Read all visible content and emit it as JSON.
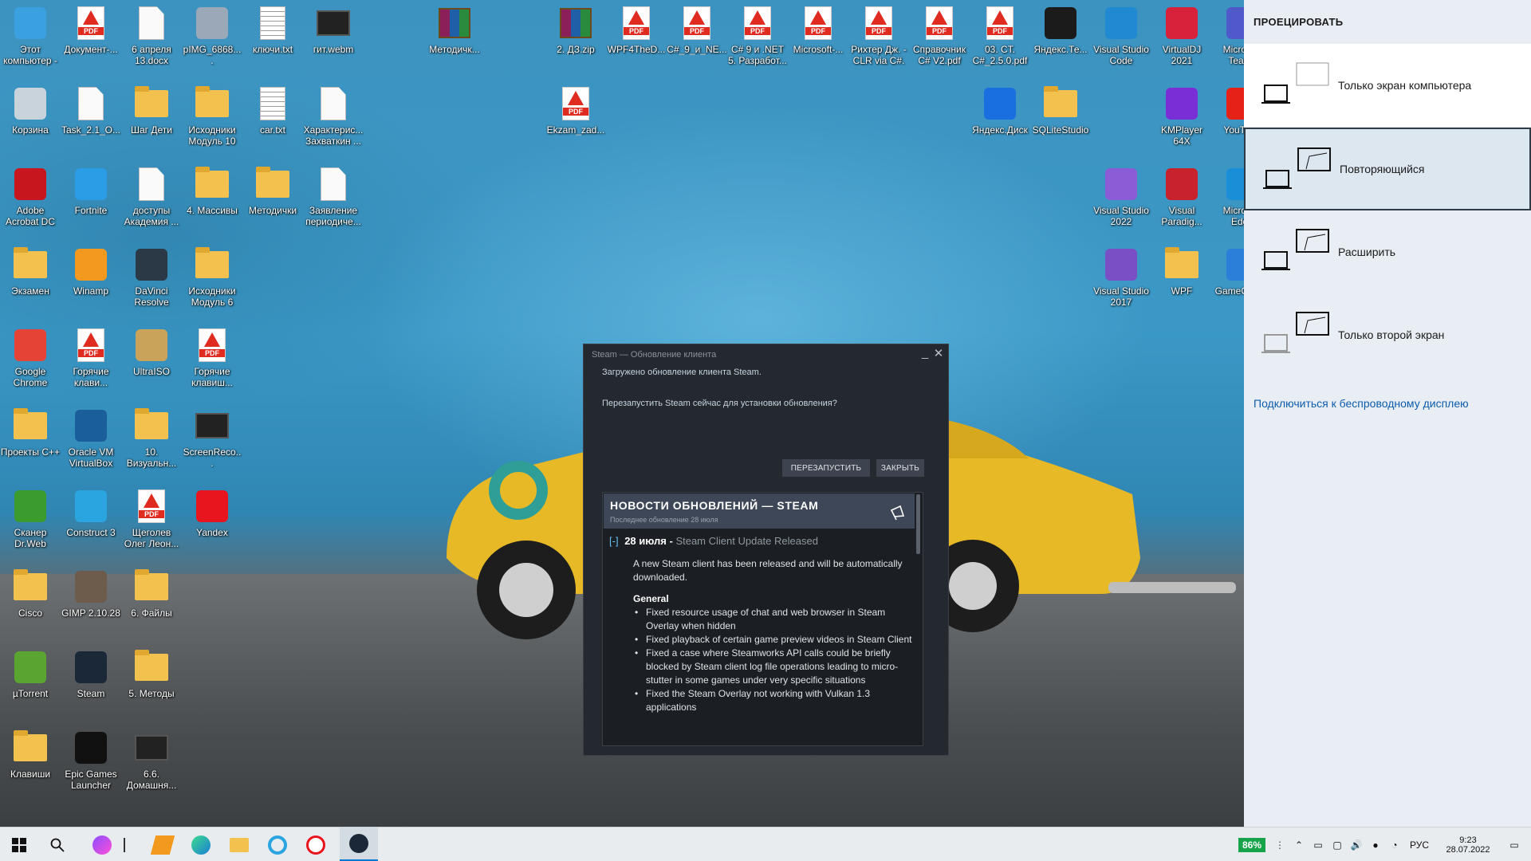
{
  "desktop": {
    "icons": [
      {
        "label": "Этот компьютер -",
        "kind": "box",
        "color": "#3aa0e0",
        "col": 0,
        "row": 0
      },
      {
        "label": "Документ-...",
        "kind": "pdf",
        "col": 1,
        "row": 0
      },
      {
        "label": "6 апреля 13.docx",
        "kind": "doc",
        "col": 2,
        "row": 0
      },
      {
        "label": "pIMG_6868....",
        "kind": "box",
        "color": "#9aa8b8",
        "col": 3,
        "row": 0
      },
      {
        "label": "ключи.txt",
        "kind": "txt",
        "col": 4,
        "row": 0
      },
      {
        "label": "гит.webm",
        "kind": "vid",
        "col": 5,
        "row": 0
      },
      {
        "label": "Методичк...",
        "kind": "arch",
        "col": 7,
        "row": 0
      },
      {
        "label": "2. ДЗ.zip",
        "kind": "arch",
        "col": 9,
        "row": 0
      },
      {
        "label": "WPF4TheD...",
        "kind": "pdf",
        "col": 10,
        "row": 0
      },
      {
        "label": "C#_9_и_NE...",
        "kind": "pdf",
        "col": 11,
        "row": 0
      },
      {
        "label": "C# 9 и .NET 5. Разработ...",
        "kind": "pdf",
        "col": 12,
        "row": 0
      },
      {
        "label": "Microsoft-...",
        "kind": "pdf",
        "col": 13,
        "row": 0
      },
      {
        "label": "Рихтер Дж. - CLR via C#. ...",
        "kind": "pdf",
        "col": 14,
        "row": 0
      },
      {
        "label": "Справочник C# V2.pdf",
        "kind": "pdf",
        "col": 15,
        "row": 0
      },
      {
        "label": "03. CT. C#_2.5.0.pdf",
        "kind": "pdf",
        "col": 16,
        "row": 0
      },
      {
        "label": "Яндекс.Те...",
        "kind": "box",
        "color": "#1b1b1b",
        "col": 17,
        "row": 0
      },
      {
        "label": "Visual Studio Code",
        "kind": "box",
        "color": "#1f8ad2",
        "col": 18,
        "row": 0
      },
      {
        "label": "VirtualDJ 2021",
        "kind": "box",
        "color": "#d8213a",
        "col": 19,
        "row": 0
      },
      {
        "label": "Microsoft Teams",
        "kind": "box",
        "color": "#5059c9",
        "col": 20,
        "row": 0
      },
      {
        "label": "Корзина",
        "kind": "box",
        "color": "#c8d3dc",
        "col": 0,
        "row": 1
      },
      {
        "label": "Task_2.1_O...",
        "kind": "doc",
        "col": 1,
        "row": 1
      },
      {
        "label": "Шаг Дети",
        "kind": "folder",
        "col": 2,
        "row": 1
      },
      {
        "label": "Исходники Модуль 10",
        "kind": "folder",
        "col": 3,
        "row": 1
      },
      {
        "label": "car.txt",
        "kind": "txt",
        "col": 4,
        "row": 1
      },
      {
        "label": "Характерис... Захваткин ...",
        "kind": "doc",
        "col": 5,
        "row": 1
      },
      {
        "label": "Ekzam_zad...",
        "kind": "pdf",
        "col": 9,
        "row": 1
      },
      {
        "label": "Яндекс.Диск",
        "kind": "box",
        "color": "#1a6fe0",
        "col": 16,
        "row": 1
      },
      {
        "label": "SQLiteStudio",
        "kind": "folder",
        "col": 17,
        "row": 1
      },
      {
        "label": "KMPlayer 64X",
        "kind": "box",
        "color": "#7a2fd6",
        "col": 19,
        "row": 1
      },
      {
        "label": "YouTube",
        "kind": "box",
        "color": "#e62117",
        "col": 20,
        "row": 1
      },
      {
        "label": "Adobe Acrobat DC",
        "kind": "box",
        "color": "#c7161d",
        "col": 0,
        "row": 2
      },
      {
        "label": "Fortnite",
        "kind": "box",
        "color": "#2b9de6",
        "col": 1,
        "row": 2
      },
      {
        "label": "доступы Академия ...",
        "kind": "doc",
        "col": 2,
        "row": 2
      },
      {
        "label": "4. Массивы",
        "kind": "folder",
        "col": 3,
        "row": 2
      },
      {
        "label": "Методички",
        "kind": "folder",
        "col": 4,
        "row": 2
      },
      {
        "label": "Заявление периодиче...",
        "kind": "doc",
        "col": 5,
        "row": 2
      },
      {
        "label": "Visual Studio 2022",
        "kind": "box",
        "color": "#8a5cd6",
        "col": 18,
        "row": 2
      },
      {
        "label": "Visual Paradig...",
        "kind": "box",
        "color": "#c8232c",
        "col": 19,
        "row": 2
      },
      {
        "label": "Microsoft Edge",
        "kind": "box",
        "color": "#1a8fd8",
        "col": 20,
        "row": 2
      },
      {
        "label": "Экзамен",
        "kind": "folder",
        "col": 0,
        "row": 3
      },
      {
        "label": "Winamp",
        "kind": "box",
        "color": "#f39a1e",
        "col": 1,
        "row": 3
      },
      {
        "label": "DaVinci Resolve",
        "kind": "box",
        "color": "#2b3947",
        "col": 2,
        "row": 3
      },
      {
        "label": "Исходники Модуль 6",
        "kind": "folder",
        "col": 3,
        "row": 3
      },
      {
        "label": "Visual Studio 2017",
        "kind": "box",
        "color": "#7a4fc6",
        "col": 18,
        "row": 3
      },
      {
        "label": "WPF",
        "kind": "folder",
        "col": 19,
        "row": 3
      },
      {
        "label": "GameCenter",
        "kind": "box",
        "color": "#2a7fd8",
        "col": 20,
        "row": 3
      },
      {
        "label": "Google Chrome",
        "kind": "box",
        "color": "#e44335",
        "col": 0,
        "row": 4
      },
      {
        "label": "Горячие клави...",
        "kind": "pdf",
        "col": 1,
        "row": 4
      },
      {
        "label": "UltraISO",
        "kind": "box",
        "color": "#c9a35a",
        "col": 2,
        "row": 4
      },
      {
        "label": "Горячие клавиш...",
        "kind": "pdf",
        "col": 3,
        "row": 4
      },
      {
        "label": "Проекты C++",
        "kind": "folder",
        "col": 0,
        "row": 5
      },
      {
        "label": "Oracle VM VirtualBox",
        "kind": "box",
        "color": "#1b5e9c",
        "col": 1,
        "row": 5
      },
      {
        "label": "10. Визуальн...",
        "kind": "folder",
        "col": 2,
        "row": 5
      },
      {
        "label": "ScreenReco...",
        "kind": "vid",
        "col": 3,
        "row": 5
      },
      {
        "label": "Сканер Dr.Web",
        "kind": "box",
        "color": "#3c9b2f",
        "col": 0,
        "row": 6
      },
      {
        "label": "Construct 3",
        "kind": "box",
        "color": "#2aa5e0",
        "col": 1,
        "row": 6
      },
      {
        "label": "Щеголев Олег Леон...",
        "kind": "pdf",
        "col": 2,
        "row": 6
      },
      {
        "label": "Yandex",
        "kind": "box",
        "color": "#e8141e",
        "col": 3,
        "row": 6
      },
      {
        "label": "Cisco",
        "kind": "folder",
        "col": 0,
        "row": 7
      },
      {
        "label": "GIMP 2.10.28",
        "kind": "box",
        "color": "#6d5b4b",
        "col": 1,
        "row": 7
      },
      {
        "label": "6. Файлы",
        "kind": "folder",
        "col": 2,
        "row": 7
      },
      {
        "label": "µTorrent",
        "kind": "box",
        "color": "#5aa531",
        "col": 0,
        "row": 8
      },
      {
        "label": "Steam",
        "kind": "box",
        "color": "#1b2838",
        "col": 1,
        "row": 8
      },
      {
        "label": "5. Методы",
        "kind": "folder",
        "col": 2,
        "row": 8
      },
      {
        "label": "Клавиши",
        "kind": "folder",
        "col": 0,
        "row": 9
      },
      {
        "label": "Epic Games Launcher",
        "kind": "box",
        "color": "#111111",
        "col": 1,
        "row": 9
      },
      {
        "label": "6.6. Домашня...",
        "kind": "vid",
        "col": 2,
        "row": 9
      }
    ]
  },
  "steam_dialog": {
    "title": "Steam — Обновление клиента",
    "minimize": "_",
    "close": "✕",
    "message1": "Загружено обновление клиента Steam.",
    "message2": "Перезапустить Steam сейчас для установки обновления?",
    "restart_label": "ПЕРЕЗАПУСТИТЬ",
    "close_label": "ЗАКРЫТЬ",
    "news": {
      "header": "НОВОСТИ ОБНОВЛЕНИЙ — STEAM",
      "subheader": "Последнее обновление 28 июля",
      "toggle": "[-]",
      "date": "28 июля",
      "sep": " - ",
      "entry_title": "Steam Client Update Released",
      "intro": "A new Steam client has been released and will be automatically downloaded.",
      "section": "General",
      "items": [
        "Fixed resource usage of chat and web browser in Steam Overlay when hidden",
        "Fixed playback of certain game preview videos in Steam Client",
        "Fixed a case where Steamworks API calls could be briefly blocked by Steam client log file operations leading to micro-stutter in some games under very specific situations",
        "Fixed the Steam Overlay not working with Vulkan 1.3 applications"
      ]
    }
  },
  "project_panel": {
    "title": "ПРОЕЦИРОВАТЬ",
    "options": [
      {
        "label": "Только экран компьютера",
        "selected": false
      },
      {
        "label": "Повторяющийся",
        "selected": true
      },
      {
        "label": "Расширить",
        "selected": false
      },
      {
        "label": "Только второй экран",
        "selected": false
      }
    ],
    "wireless_link": "Подключиться к беспроводному дисплею"
  },
  "taskbar": {
    "battery": "86%",
    "language": "РУС",
    "time": "9:23",
    "date": "28.07.2022",
    "colors": {
      "accent": "#0078d4",
      "battery_green": "#16a34a"
    }
  }
}
